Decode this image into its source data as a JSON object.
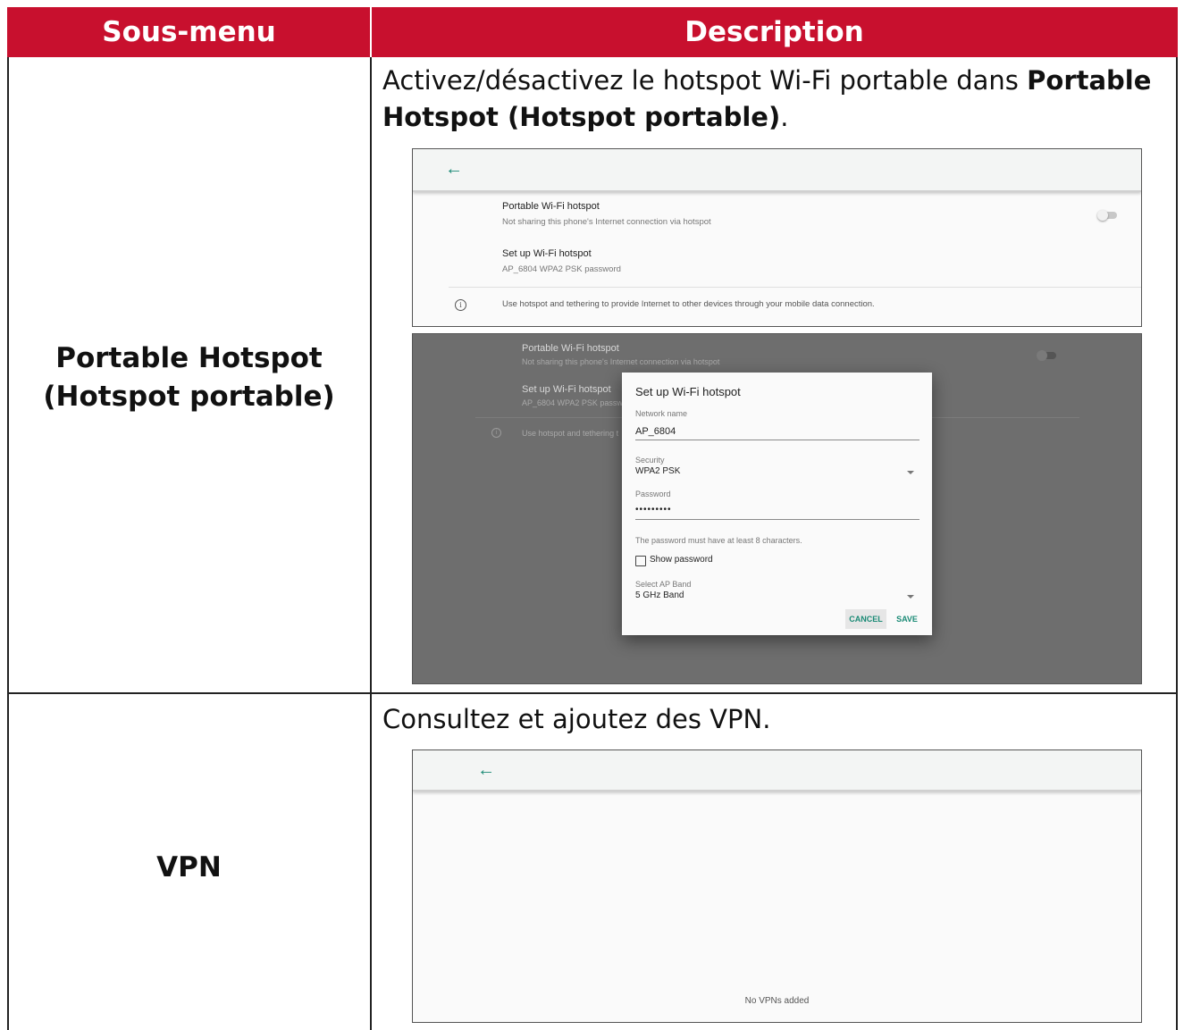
{
  "table": {
    "header": {
      "col1": "Sous-menu",
      "col2": "Description"
    },
    "rows": [
      {
        "submenu_line1": "Portable Hotspot",
        "submenu_line2": "(Hotspot portable)",
        "desc_prefix": "Activez/désactivez le hotspot Wi-Fi portable dans ",
        "desc_bold_1": "Portable",
        "desc_bold_2": "Hotspot (Hotspot portable)",
        "desc_suffix": "."
      },
      {
        "submenu": "VPN",
        "desc": "Consultez et ajoutez des VPN."
      }
    ]
  },
  "hotspot_screen": {
    "portable_wifi_title": "Portable Wi-Fi hotspot",
    "portable_wifi_subtitle": "Not sharing this phone's Internet connection via hotspot",
    "toggle_on": false,
    "setup_title": "Set up Wi-Fi hotspot",
    "setup_subtitle": "AP_6804 WPA2 PSK password",
    "info_text": "Use hotspot and tethering to provide Internet to other devices through your mobile data connection.",
    "background_setup_subtitle": "AP_6804 WPA2 PSK passw",
    "background_info_text": "Use hotspot and tethering t"
  },
  "setup_dialog": {
    "title": "Set up Wi-Fi hotspot",
    "network_name_label": "Network name",
    "network_name_value": "AP_6804",
    "security_label": "Security",
    "security_value": "WPA2 PSK",
    "password_label": "Password",
    "password_value": "•••••••••",
    "password_hint": "The password must have at least 8 characters.",
    "show_password_label": "Show password",
    "show_password_checked": false,
    "ap_band_label": "Select AP Band",
    "ap_band_value": "5 GHz Band",
    "cancel_label": "CANCEL",
    "save_label": "SAVE"
  },
  "vpn_screen": {
    "empty_text": "No VPNs added"
  },
  "icons": {
    "back": "arrow-left-icon",
    "info": "info-icon",
    "dropdown": "caret-down-icon",
    "checkbox": "checkbox-icon"
  },
  "colors": {
    "header_bg": "#c8102e",
    "accent": "#1a8a75"
  }
}
